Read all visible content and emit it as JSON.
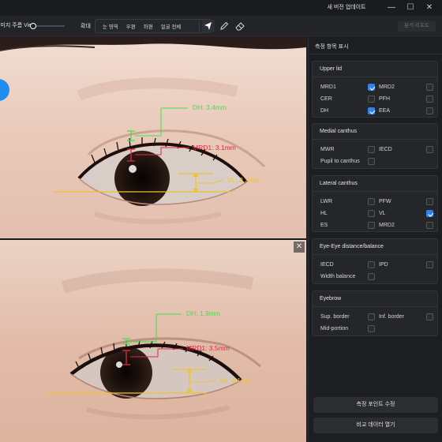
{
  "titlebar": {
    "update_label": "새 버전 업데이트",
    "minimize": "—",
    "maximize": "☐",
    "close": "✕"
  },
  "toolbar": {
    "zoom_label": "이미지 주름 View",
    "zoom_in_label": "확대",
    "view_options": [
      "눈 영역",
      "우편",
      "좌편",
      "얼굴 전체"
    ],
    "export_label": "분석 리포트"
  },
  "photos": {
    "top": {
      "dh": "DH: 3.4mm",
      "mrd1": "MRD1: 3.1mm",
      "vl": "VL: 3.2mm"
    },
    "bottom": {
      "dh": "DH: 1.9mm",
      "mrd1": "MRD1: 3.5mm",
      "vl": "VL: 4.1mm"
    },
    "close_label": "✕"
  },
  "colors": {
    "accent": "#2f82e8",
    "green": "#3fe34a",
    "red": "#e0283e",
    "yellow": "#f2c12e"
  },
  "panel": {
    "title": "측정 항목 표시",
    "groups": [
      {
        "title": "Upper lid",
        "items": [
          {
            "label": "MRD1",
            "checked": true
          },
          {
            "label": "MRD2",
            "checked": false
          },
          {
            "label": "CER",
            "checked": false
          },
          {
            "label": "PFH",
            "checked": false
          },
          {
            "label": "DH",
            "checked": true
          },
          {
            "label": "EEA",
            "checked": false
          }
        ]
      },
      {
        "title": "Medial canthus",
        "items": [
          {
            "label": "MWR",
            "checked": false
          },
          {
            "label": "IECD",
            "checked": false
          },
          {
            "label": "Pupil to canthus",
            "checked": false
          }
        ]
      },
      {
        "title": "Lateral canthus",
        "items": [
          {
            "label": "LWR",
            "checked": false
          },
          {
            "label": "PFW",
            "checked": false
          },
          {
            "label": "HL",
            "checked": false
          },
          {
            "label": "VL",
            "checked": true
          },
          {
            "label": "ES",
            "checked": false
          },
          {
            "label": "MRD2",
            "checked": false
          }
        ]
      },
      {
        "title": "Eye-Eye distance/balance",
        "items": [
          {
            "label": "IECD",
            "checked": false
          },
          {
            "label": "IPD",
            "checked": false
          },
          {
            "label": "Width balance",
            "checked": false
          }
        ]
      },
      {
        "title": "Eyebrow",
        "items": [
          {
            "label": "Sup. border",
            "checked": false
          },
          {
            "label": "Inf. border",
            "checked": false
          },
          {
            "label": "Mid-portion",
            "checked": false
          }
        ]
      }
    ],
    "edit_points_label": "측정 포인트 수정",
    "compare_label": "비교 데이터 열기"
  }
}
